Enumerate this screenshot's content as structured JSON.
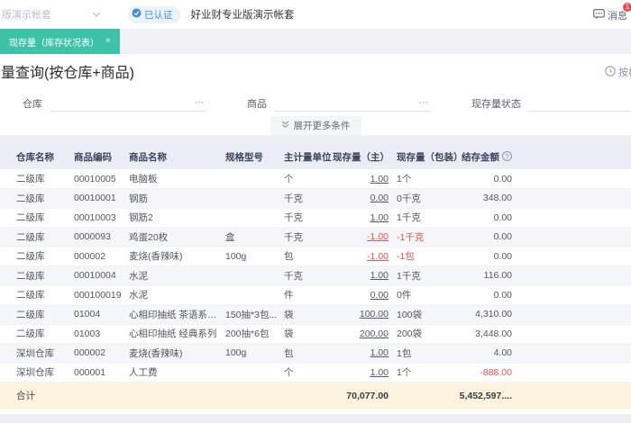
{
  "topbar": {
    "account_select": "版演示帐套",
    "verified_badge": "已认证",
    "company": "好业财专业版演示帐套",
    "messages_label": "消息",
    "messages_count": "1"
  },
  "tabs": [
    {
      "label": "现存量（库存状况表）",
      "close": "×",
      "active": true
    }
  ],
  "page": {
    "title": "量查询(按仓库+商品)",
    "top_right_action": "按相"
  },
  "filters": {
    "fields": [
      {
        "label": "仓库",
        "more": "⋯"
      },
      {
        "label": "商品",
        "more": "⋯"
      },
      {
        "label": "现存量状态",
        "more": ""
      }
    ],
    "expand_button": "展开更多条件"
  },
  "table": {
    "columns": [
      "仓库名称",
      "商品编码",
      "商品名称",
      "规格型号",
      "主计量单位",
      "现存量（主）",
      "现存量（包装）",
      "结存金额"
    ],
    "help_icon": "?",
    "rows": [
      {
        "warehouse": "二级库",
        "code": "00010005",
        "name": "电脑板",
        "spec": "",
        "unit": "个",
        "qty": "1.00",
        "qty_pkg": "1个",
        "amount": "0.00",
        "qty_negative": false,
        "amount_negative": false
      },
      {
        "warehouse": "二级库",
        "code": "00010001",
        "name": "钢筋",
        "spec": "",
        "unit": "千克",
        "qty": "0.00",
        "qty_pkg": "0千克",
        "amount": "348.00",
        "qty_negative": false,
        "amount_negative": false
      },
      {
        "warehouse": "二级库",
        "code": "00010003",
        "name": "钢筋2",
        "spec": "",
        "unit": "千克",
        "qty": "1.00",
        "qty_pkg": "1千克",
        "amount": "0.00",
        "qty_negative": false,
        "amount_negative": false
      },
      {
        "warehouse": "二级库",
        "code": "0000093",
        "name": "鸡蛋20枚",
        "spec": "盒",
        "unit": "千克",
        "qty": "-1.00",
        "qty_pkg": "-1千克",
        "amount": "0.00",
        "qty_negative": true,
        "amount_negative": false
      },
      {
        "warehouse": "二级库",
        "code": "000002",
        "name": "麦烧(香辣味)",
        "spec": "100g",
        "unit": "包",
        "qty": "-1.00",
        "qty_pkg": "-1包",
        "amount": "0.00",
        "qty_negative": true,
        "amount_negative": false
      },
      {
        "warehouse": "二级库",
        "code": "00010004",
        "name": "水泥",
        "spec": "",
        "unit": "千克",
        "qty": "1.00",
        "qty_pkg": "1千克",
        "amount": "116.00",
        "qty_negative": false,
        "amount_negative": false
      },
      {
        "warehouse": "二级库",
        "code": "000100019",
        "name": "水泥",
        "spec": "",
        "unit": "件",
        "qty": "0.00",
        "qty_pkg": "0件",
        "amount": "0.00",
        "qty_negative": false,
        "amount_negative": false
      },
      {
        "warehouse": "二级库",
        "code": "01004",
        "name": "心相印抽纸 茶语系列 ...",
        "spec": "150抽*3包...",
        "unit": "袋",
        "qty": "100.00",
        "qty_pkg": "100袋",
        "amount": "4,310.00",
        "qty_negative": false,
        "amount_negative": false
      },
      {
        "warehouse": "二级库",
        "code": "01003",
        "name": "心相印抽纸 经典系列",
        "spec": "200抽*6包",
        "unit": "袋",
        "qty": "200.00",
        "qty_pkg": "200袋",
        "amount": "3,448.00",
        "qty_negative": false,
        "amount_negative": false
      },
      {
        "warehouse": "深圳仓库",
        "code": "000002",
        "name": "麦烧(香辣味)",
        "spec": "100g",
        "unit": "包",
        "qty": "1.00",
        "qty_pkg": "1包",
        "amount": "4.00",
        "qty_negative": false,
        "amount_negative": false
      },
      {
        "warehouse": "深圳仓库",
        "code": "000001",
        "name": "人工费",
        "spec": "",
        "unit": "个",
        "qty": "1.00",
        "qty_pkg": "1个",
        "amount": "-888.00",
        "qty_negative": false,
        "amount_negative": true
      }
    ],
    "footer": {
      "label": "合计",
      "qty_total": "70,077.00",
      "amount_total": "5,452,597...."
    }
  },
  "colors": {
    "accent_green": "#3ec3a8",
    "negative_red": "#f25249",
    "badge_blue": "#4a8bd8",
    "header_bg": "#ebedf4",
    "footer_bg": "#fbf3de"
  }
}
